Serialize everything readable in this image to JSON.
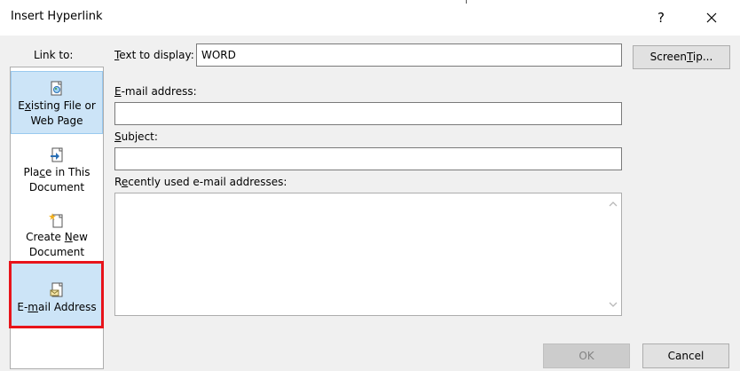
{
  "window": {
    "title": "Insert Hyperlink",
    "help_label": "?"
  },
  "link_to": {
    "label": "Link to:",
    "items": [
      {
        "line1": "Existing File or",
        "line2": "Web Page",
        "underline_index": 1,
        "icon": "existing-file-icon",
        "selected": false
      },
      {
        "line1": "Place in This",
        "line2": "Document",
        "underline_index": 3,
        "icon": "place-in-document-icon",
        "selected": false
      },
      {
        "line1": "Create New",
        "line2": "Document",
        "underline_index": 7,
        "icon": "create-new-document-icon",
        "selected": false
      },
      {
        "line1": "E-mail Address",
        "line2": "",
        "underline_index": 2,
        "icon": "email-address-icon",
        "selected": true
      }
    ]
  },
  "form": {
    "text_to_display_label": "Text to display:",
    "text_to_display_value": "WORD",
    "screentip_label": "ScreenTip...",
    "email_address_label": "E-mail address:",
    "email_address_value": "",
    "subject_label": "Subject:",
    "subject_value": "",
    "recent_label": "Recently used e-mail addresses:",
    "recent_items": []
  },
  "buttons": {
    "ok_label": "OK",
    "cancel_label": "Cancel"
  },
  "colors": {
    "selected_bg": "#cce4f7",
    "highlight_border": "#e8141b"
  }
}
